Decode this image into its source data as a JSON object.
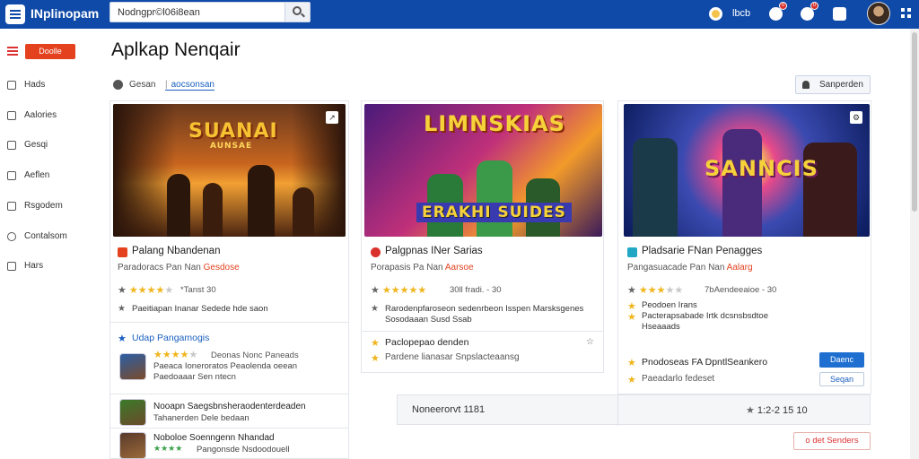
{
  "topbar": {
    "app_name": "INplinopam",
    "search_value": "Nodngpr©l06i8ean",
    "account_label": "lbcb",
    "badges": [
      "0",
      "0"
    ]
  },
  "sidebar": {
    "action_button": "Doolle",
    "items": [
      {
        "label": "Hads",
        "icon": "home-icon"
      },
      {
        "label": "Aalories",
        "icon": "category-icon"
      },
      {
        "label": "Gesqi",
        "icon": "bag-icon"
      },
      {
        "label": "Aeflen",
        "icon": "book-icon"
      },
      {
        "label": "Rsgodem",
        "icon": "doc-icon"
      },
      {
        "label": "Contalsom",
        "icon": "circle-icon"
      },
      {
        "label": "Hars",
        "icon": "grid-icon"
      }
    ]
  },
  "page": {
    "title": "Aplkap Nenqair",
    "filter_label": "Gesan",
    "filter_link": "aocsonsan",
    "sort_button": "Sanperden"
  },
  "cards": [
    {
      "thumb_title": "SUANAI",
      "thumb_subtitle": "AUNSAE",
      "title": "Palang Nbandenan",
      "sub_prefix": "Paradoracs Pan Nan",
      "sub_accent": "Gesdose",
      "rating": 4,
      "rating_meta": "*Tanst 30",
      "note": "Paeitiapan Inanar Sedede hde saon",
      "section_link": "Udap Pangamogis",
      "related": [
        {
          "title": "Deonas Nonc Paneads",
          "lines": [
            "Paeaca Ioneroratos Peaolenda oeean",
            "Paedoaaar Sen ntecn"
          ],
          "rating": 4
        },
        {
          "title": "Nooapn Saegsbnsheraodenterdeaden",
          "lines": [
            "Tahanerden Dele bedaan"
          ],
          "rating": 0
        },
        {
          "title": "Noboloe Soenngenn Nhandad",
          "lines": [
            "Pangonsde Nsdoodouell"
          ],
          "rating": 4
        }
      ]
    },
    {
      "thumb_title": "LIMNSKIAS",
      "thumb_subtitle": "ERAKHI SUIDES",
      "title": "Palgpnas INer Sarias",
      "sub_prefix": "Porapasis Pa Nan",
      "sub_accent": "Aarsoe",
      "rating": 5,
      "rating_meta": "30ll fradi. - 30",
      "note_lines": [
        "Rarodenpfaroseon sedenrbeon Isspen Marsksgenes",
        "Sosodaaan Susd Ssab"
      ],
      "featured": "Paclopepao denden",
      "featured_sub": "Pardene lianasar Snpslacteaansg"
    },
    {
      "thumb_title": "SANNCIS",
      "title": "Pladsarie FNan Penagges",
      "sub_prefix": "Pangasuacade Pan Nan",
      "sub_accent": "Aalarg",
      "rating": 3,
      "rating_meta": "7bAendeeaioe - 30",
      "note_lines": [
        "Peodoen Irans",
        "Pacterapsabade Irtk dcsnsbsdtoe",
        "Hseaaads"
      ],
      "featured": "Pnodoseas FA DpntlSeankero",
      "featured_sub": "Paeadarlo fedeset",
      "primary_button": "Daenc",
      "secondary_button": "Seqan"
    }
  ],
  "bottom": {
    "left_text": "Noneerorvt 1181",
    "right_text": "1:2-2 15 10",
    "action": "o det Senders"
  },
  "colors": {
    "brand": "#0f4aa8",
    "accent": "#e4421f",
    "link": "#1a5fc0",
    "star": "#f1b51c"
  }
}
